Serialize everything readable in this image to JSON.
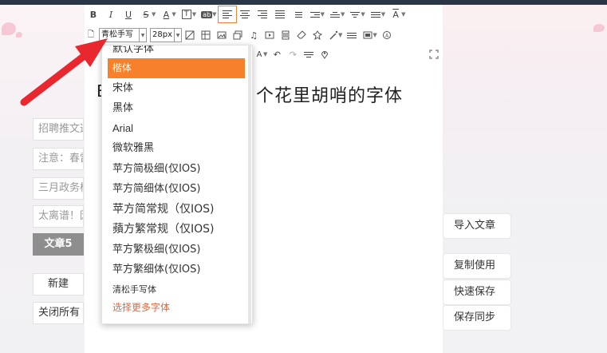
{
  "toolbar": {
    "row1": [
      "B",
      "I",
      "U",
      "S",
      "A",
      "T",
      "ab"
    ],
    "font_name": "青松手写",
    "font_size": "28px"
  },
  "content": {
    "left_char": "B",
    "text": "个花里胡哨的字体"
  },
  "font_dropdown": {
    "items": [
      "默认字体",
      "楷体",
      "宋体",
      "黑体",
      "Arial",
      "微软雅黑",
      "苹方简极细(仅IOS)",
      "苹方简细体(仅IOS)",
      "苹方简常规（仅IOS)",
      "蘋方繁常规（仅IOS)",
      "苹方繁极细(仅IOS)",
      "苹方繁细体(仅IOS)",
      "清松手写体"
    ],
    "selected": "楷体",
    "more_link": "选择更多字体"
  },
  "left_panel": {
    "fields": [
      "招聘推文这",
      "注意：春雷",
      "三月政务楼",
      "太离谱！因"
    ],
    "active_tab": "文章5",
    "new_button": "新建",
    "close_all_button": "关闭所有"
  },
  "right_panel": {
    "import_button": "导入文章",
    "copy_button": "复制使用",
    "quick_save_button": "快速保存",
    "save_sync_button": "保存同步"
  },
  "colors": {
    "accent": "#f7802d",
    "link": "#e8643c",
    "arrow": "#e8282e"
  }
}
